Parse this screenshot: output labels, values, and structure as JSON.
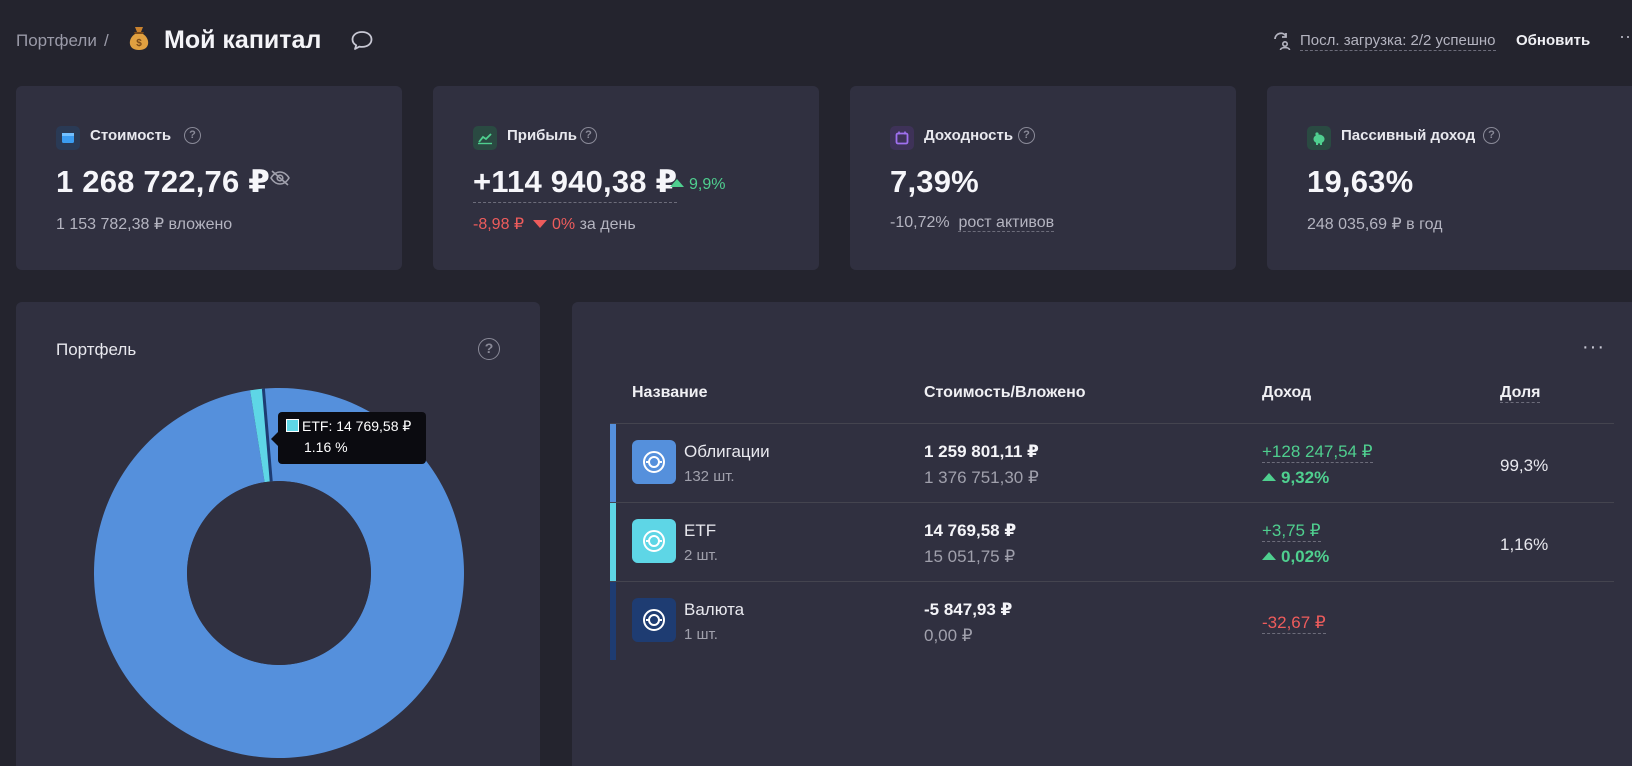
{
  "header": {
    "breadcrumb": "Портфели",
    "separator": "/",
    "title": "Мой капитал",
    "sync_status": "Посл. загрузка: 2/2 успешно",
    "refresh_label": "Обновить",
    "edge_menu": "··"
  },
  "cards": [
    {
      "label": "Стоимость",
      "value": "1 268 722,76 ₽",
      "sub": "1 153 782,38 ₽ вложено",
      "icon": "wallet-icon",
      "color": "#2d7fd0"
    },
    {
      "label": "Прибыль",
      "value": "+114 940,38 ₽",
      "change": "9,9%",
      "day_value": "-8,98 ₽",
      "day_pct": "0%",
      "day_label": "за день",
      "icon": "chart-line-icon",
      "color": "#2fb56f"
    },
    {
      "label": "Доходность",
      "value": "7,39%",
      "sub_value": "-10,72%",
      "sub_link": "рост активов",
      "icon": "calendar-icon",
      "color": "#8c5ad8"
    },
    {
      "label": "Пассивный доход",
      "value": "19,63%",
      "sub": "248 035,69 ₽ в год",
      "icon": "piggy-bank-icon",
      "color": "#2fb56f"
    }
  ],
  "portfolio": {
    "title": "Портфель",
    "help": "?",
    "tooltip_line1": "ETF: 14 769,58 ₽",
    "tooltip_line2": "1.16 %"
  },
  "chart_data": {
    "type": "pie",
    "labels": [
      "Облигации",
      "ETF",
      "Валюта"
    ],
    "values": [
      99.3,
      1.16,
      0
    ],
    "colors": [
      "#5590dc",
      "#5ed6e6",
      "#1e3c72"
    ],
    "title": ""
  },
  "table": {
    "more": "···",
    "headers": {
      "name": "Название",
      "value": "Стоимость/Вложено",
      "income": "Доход",
      "share": "Доля"
    },
    "rows": [
      {
        "name": "Облигации",
        "count": "132 шт.",
        "value": "1 259 801,11 ₽",
        "invested": "1 376 751,30 ₽",
        "income": "+128 247,54 ₽",
        "income_pct": "9,32%",
        "share": "99,3%",
        "bar_color": "#5590dc",
        "icon_bg": "#5590dc",
        "income_dir": "up"
      },
      {
        "name": "ETF",
        "count": "2 шт.",
        "value": "14 769,58 ₽",
        "invested": "15 051,75 ₽",
        "income": "+3,75 ₽",
        "income_pct": "0,02%",
        "share": "1,16%",
        "bar_color": "#5ed6e6",
        "icon_bg": "#5ed6e6",
        "income_dir": "up"
      },
      {
        "name": "Валюта",
        "count": "1 шт.",
        "value": "-5 847,93 ₽",
        "invested": "0,00 ₽",
        "income": "-32,67 ₽",
        "income_pct": "",
        "share": "",
        "bar_color": "#1e3c72",
        "icon_bg": "#1e3c72",
        "income_dir": "down"
      }
    ]
  }
}
